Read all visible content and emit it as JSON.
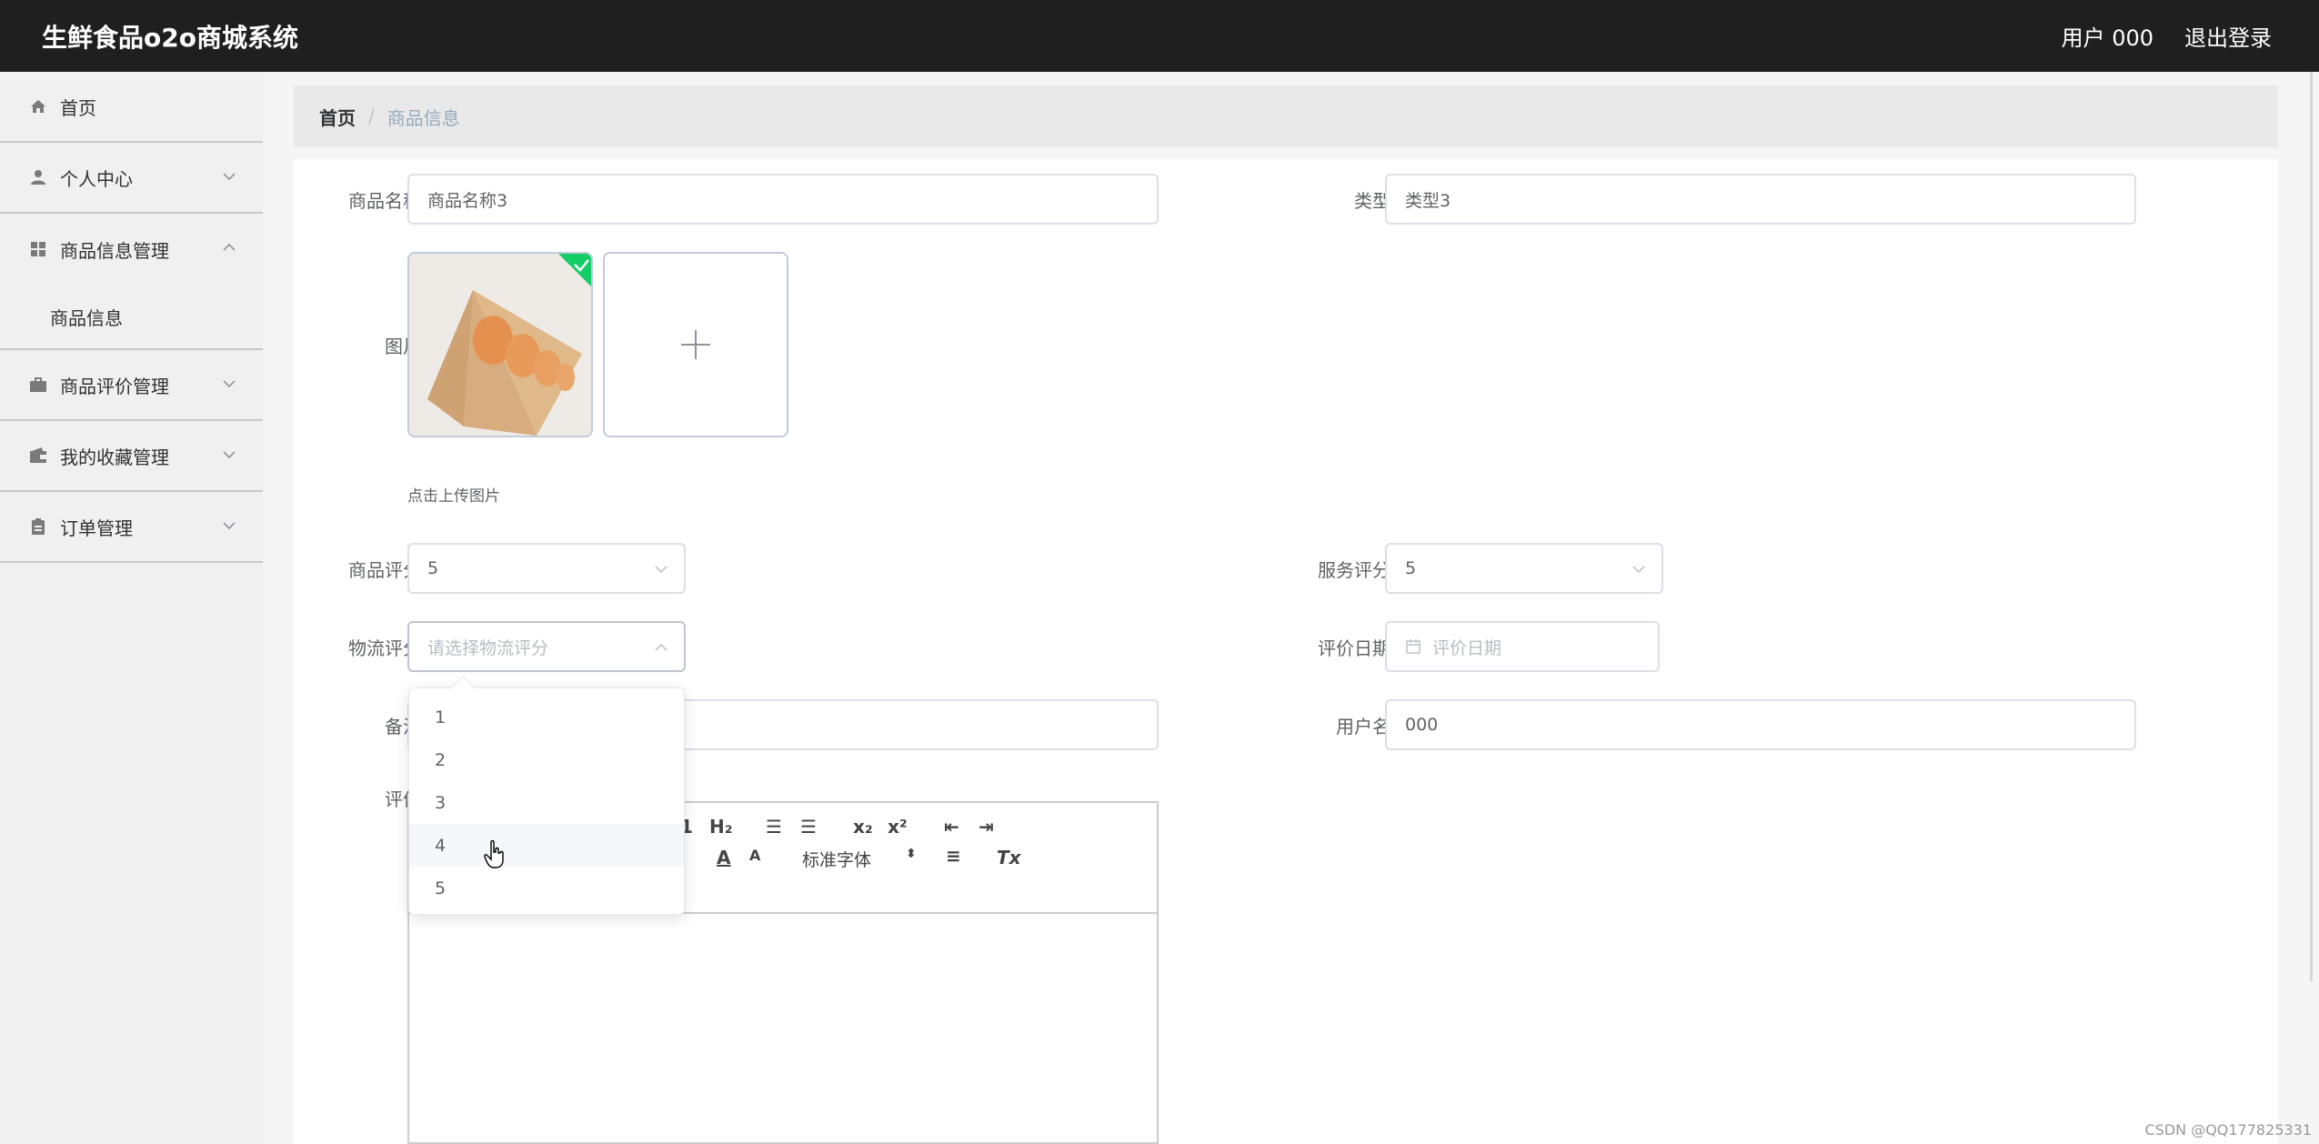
{
  "header": {
    "title": "生鲜食品o2o商城系统",
    "user": "用户 000",
    "logout": "退出登录"
  },
  "sidebar": {
    "home": "首页",
    "personal": "个人中心",
    "goods_mgmt": "商品信息管理",
    "goods_info": "商品信息",
    "review_mgmt": "商品评价管理",
    "fav_mgmt": "我的收藏管理",
    "order_mgmt": "订单管理"
  },
  "breadcrumb": {
    "home": "首页",
    "sep": "/",
    "current": "商品信息"
  },
  "form": {
    "name_label": "商品名称",
    "name_value": "商品名称3",
    "type_label": "类型",
    "type_value": "类型3",
    "image_label": "图片",
    "upload_tip": "点击上传图片",
    "goods_score_label": "商品评分",
    "goods_score_value": "5",
    "service_score_label": "服务评分",
    "service_score_value": "5",
    "logistics_label": "物流评分",
    "logistics_placeholder": "请选择物流评分",
    "date_label": "评价日期",
    "date_placeholder": "评价日期",
    "remark_label": "备注",
    "username_label": "用户名",
    "username_value": "000",
    "review_label": "评价",
    "font_select": "标准字体"
  },
  "dropdown": {
    "options": [
      "1",
      "2",
      "3",
      "4",
      "5"
    ],
    "hovered": "4"
  },
  "watermark": "CSDN @QQ177825331"
}
